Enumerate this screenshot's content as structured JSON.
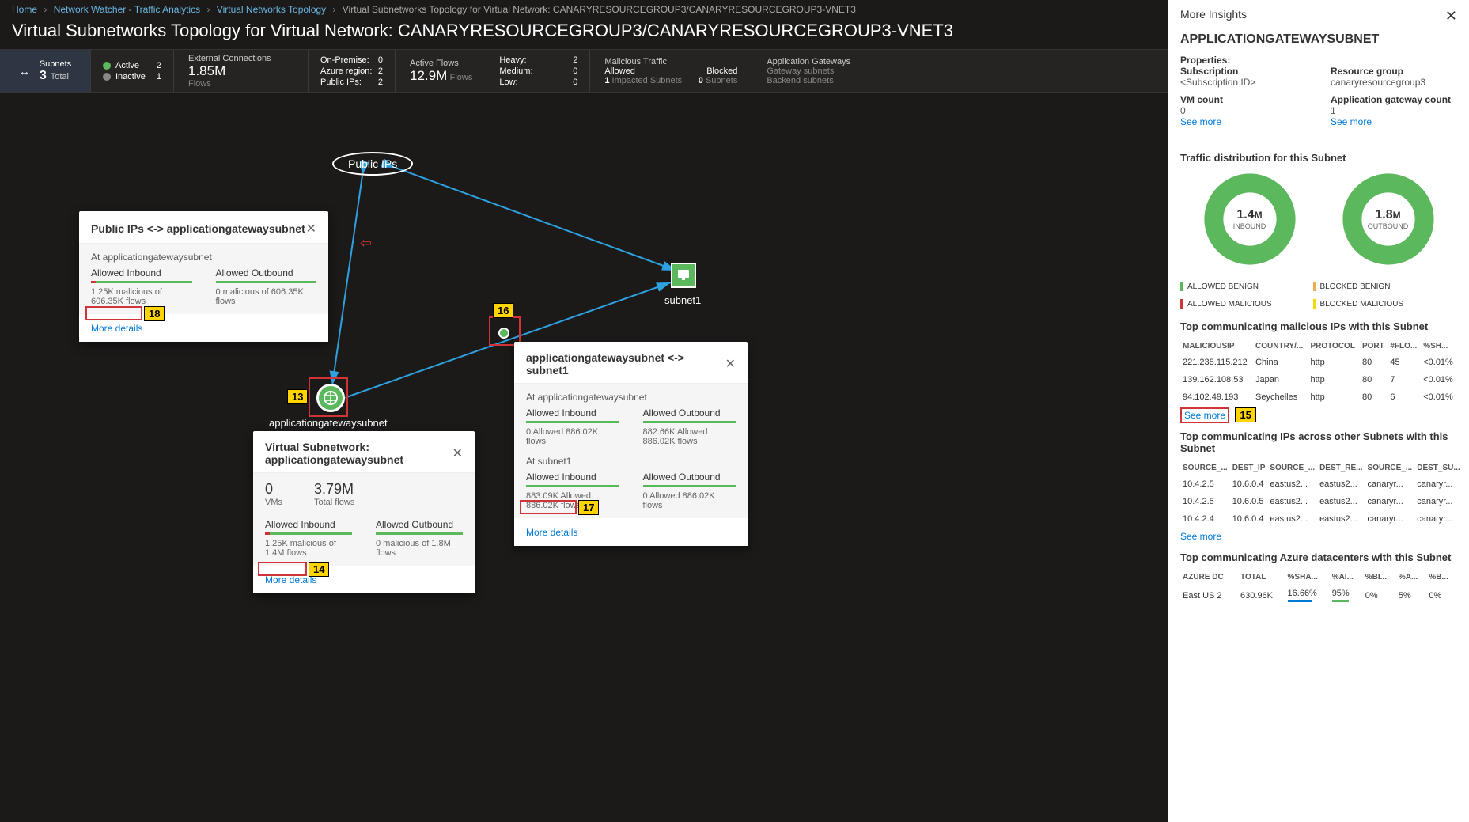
{
  "breadcrumb": {
    "items": [
      "Home",
      "Network Watcher - Traffic Analytics",
      "Virtual Networks Topology"
    ],
    "current": "Virtual Subnetworks Topology for Virtual Network: CANARYRESOURCEGROUP3/CANARYRESOURCEGROUP3-VNET3"
  },
  "page_title": "Virtual Subnetworks Topology for Virtual Network: CANARYRESOURCEGROUP3/CANARYRESOURCEGROUP3-VNET3",
  "stats": {
    "subnets": {
      "label": "Subnets",
      "count": "3",
      "total": "Total"
    },
    "status": {
      "active": {
        "label": "Active",
        "count": "2"
      },
      "inactive": {
        "label": "Inactive",
        "count": "1"
      }
    },
    "external": {
      "label": "External Connections",
      "value": "1.85M",
      "sub": "Flows"
    },
    "regions": {
      "onprem": {
        "label": "On-Premise:",
        "count": "0"
      },
      "azure": {
        "label": "Azure region:",
        "count": "2"
      },
      "publicips": {
        "label": "Public IPs:",
        "count": "2"
      }
    },
    "activeflows": {
      "label": "Active Flows",
      "value": "12.9M",
      "sub": "Flows"
    },
    "risk": {
      "heavy": {
        "label": "Heavy:",
        "count": "2"
      },
      "medium": {
        "label": "Medium:",
        "count": "0"
      },
      "low": {
        "label": "Low:",
        "count": "0"
      }
    },
    "malicious": {
      "label": "Malicious Traffic",
      "sub1": "Allowed",
      "count1": "1",
      "impacted": "Impacted Subnets",
      "sub2": "Blocked",
      "count2": "0",
      "subnets_lbl": "Subnets"
    },
    "appgw": {
      "label": "Application Gateways",
      "sub1": "Gateway subnets",
      "sub2": "Backend subnets"
    }
  },
  "topology": {
    "publicips_label": "Public IPs",
    "appgw_label": "applicationgatewaysubnet",
    "subnet1_label": "subnet1"
  },
  "popup1": {
    "title": "Public IPs <-> applicationgatewaysubnet",
    "section": "At applicationgatewaysubnet",
    "inbound_label": "Allowed Inbound",
    "inbound_detail": "1.25K malicious of 606.35K flows",
    "outbound_label": "Allowed Outbound",
    "outbound_detail": "0 malicious of 606.35K flows",
    "more_details": "More details"
  },
  "popup2": {
    "title": "Virtual Subnetwork: applicationgatewaysubnet",
    "vms_count": "0",
    "vms_label": "VMs",
    "flows_count": "3.79M",
    "flows_label": "Total flows",
    "inbound_label": "Allowed Inbound",
    "inbound_detail": "1.25K malicious of 1.4M flows",
    "outbound_label": "Allowed Outbound",
    "outbound_detail": "0 malicious of 1.8M flows",
    "more_details": "More details"
  },
  "popup3": {
    "title": "applicationgatewaysubnet <-> subnet1",
    "section1": "At applicationgatewaysubnet",
    "s1_in_label": "Allowed Inbound",
    "s1_in_detail": "0 Allowed 886.02K flows",
    "s1_out_label": "Allowed Outbound",
    "s1_out_detail": "882.66K Allowed 886.02K flows",
    "section2": "At subnet1",
    "s2_in_label": "Allowed Inbound",
    "s2_in_detail": "883.09K Allowed 886.02K flows",
    "s2_out_label": "Allowed Outbound",
    "s2_out_detail": "0 Allowed 886.02K flows",
    "more_details": "More details"
  },
  "annotations": {
    "n13": "13",
    "n14": "14",
    "n15": "15",
    "n16": "16",
    "n17": "17",
    "n18": "18"
  },
  "insights": {
    "header": "More Insights",
    "title": "APPLICATIONGATEWAYSUBNET",
    "props_label": "Properties:",
    "sub_label": "Subscription",
    "sub_value": "<Subscription ID>",
    "rg_label": "Resource group",
    "rg_value": "canaryresourcegroup3",
    "vm_label": "VM count",
    "vm_value": "0",
    "gw_label": "Application gateway count",
    "gw_value": "1",
    "see_more": "See more",
    "traffic_title": "Traffic distribution for this Subnet",
    "donut1_val": "1.4",
    "donut1_m": "M",
    "donut1_label": "INBOUND",
    "donut2_val": "1.8",
    "donut2_m": "M",
    "donut2_label": "OUTBOUND",
    "legend": {
      "ab": "ALLOWED BENIGN",
      "bb": "BLOCKED BENIGN",
      "am": "ALLOWED MALICIOUS",
      "bm": "BLOCKED MALICIOUS"
    },
    "malips_title": "Top communicating malicious IPs with this Subnet",
    "malips_headers": [
      "MALICIOUSIP",
      "COUNTRY/...",
      "PROTOCOL",
      "PORT",
      "#FLO...",
      "%SH..."
    ],
    "malips_rows": [
      [
        "221.238.115.212",
        "China",
        "http",
        "80",
        "45",
        "<0.01%"
      ],
      [
        "139.162.108.53",
        "Japan",
        "http",
        "80",
        "7",
        "<0.01%"
      ],
      [
        "94.102.49.193",
        "Seychelles",
        "http",
        "80",
        "6",
        "<0.01%"
      ]
    ],
    "subnets_title": "Top communicating IPs across other Subnets with this Subnet",
    "subnets_headers": [
      "SOURCE_...",
      "DEST_IP",
      "SOURCE_...",
      "DEST_RE...",
      "SOURCE_...",
      "DEST_SU..."
    ],
    "subnets_rows": [
      [
        "10.4.2.5",
        "10.6.0.4",
        "eastus2...",
        "eastus2...",
        "canaryr...",
        "canaryr..."
      ],
      [
        "10.4.2.5",
        "10.6.0.5",
        "eastus2...",
        "eastus2...",
        "canaryr...",
        "canaryr..."
      ],
      [
        "10.4.2.4",
        "10.6.0.4",
        "eastus2...",
        "eastus2...",
        "canaryr...",
        "canaryr..."
      ]
    ],
    "dc_title": "Top communicating Azure datacenters with this Subnet",
    "dc_headers": [
      "AZURE DC",
      "TOTAL",
      "%SHA...",
      "%AI...",
      "%BI...",
      "%A...",
      "%B..."
    ],
    "dc_rows": [
      [
        "East US 2",
        "630.96K",
        "16.66%",
        "95%",
        "0%",
        "5%",
        "0%"
      ]
    ]
  },
  "chart_data": [
    {
      "type": "pie",
      "title": "Inbound traffic distribution",
      "total": "1.4M",
      "label": "INBOUND",
      "series": [
        {
          "name": "ALLOWED BENIGN",
          "value": 99.5,
          "color": "#5cb85c"
        },
        {
          "name": "BLOCKED BENIGN",
          "value": 0,
          "color": "#f0ad4e"
        },
        {
          "name": "ALLOWED MALICIOUS",
          "value": 0.5,
          "color": "#d13438"
        },
        {
          "name": "BLOCKED MALICIOUS",
          "value": 0,
          "color": "#ffd400"
        }
      ]
    },
    {
      "type": "pie",
      "title": "Outbound traffic distribution",
      "total": "1.8M",
      "label": "OUTBOUND",
      "series": [
        {
          "name": "ALLOWED BENIGN",
          "value": 100,
          "color": "#5cb85c"
        },
        {
          "name": "BLOCKED BENIGN",
          "value": 0,
          "color": "#f0ad4e"
        },
        {
          "name": "ALLOWED MALICIOUS",
          "value": 0,
          "color": "#d13438"
        },
        {
          "name": "BLOCKED MALICIOUS",
          "value": 0,
          "color": "#ffd400"
        }
      ]
    }
  ]
}
